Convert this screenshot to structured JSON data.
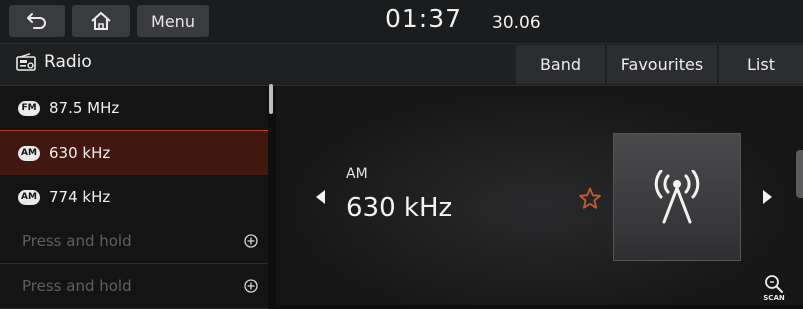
{
  "topbar": {
    "back_icon": "back-arrow-icon",
    "home_icon": "home-icon",
    "menu_label": "Menu",
    "time": "01:37",
    "date": "30.06"
  },
  "header": {
    "title": "Radio",
    "title_icon": "radio-icon",
    "buttons": [
      "Band",
      "Favourites",
      "List"
    ]
  },
  "station_list": [
    {
      "band": "FM",
      "frequency": "87.5 MHz",
      "selected": false
    },
    {
      "band": "AM",
      "frequency": "630 kHz",
      "selected": true
    },
    {
      "band": "AM",
      "frequency": "774 kHz",
      "selected": false
    },
    {
      "placeholder": "Press and hold"
    },
    {
      "placeholder": "Press and hold"
    }
  ],
  "now_playing": {
    "band": "AM",
    "frequency": "630 kHz",
    "favourite_icon": "star-outline-icon",
    "artwork_icon": "broadcast-tower-icon",
    "prev_icon": "triangle-left-icon",
    "next_icon": "triangle-right-icon",
    "scan_label": "SCAN"
  },
  "colors": {
    "accent": "#c85a2e",
    "selected_row": "#40180f",
    "background": "#0e0e0f"
  }
}
